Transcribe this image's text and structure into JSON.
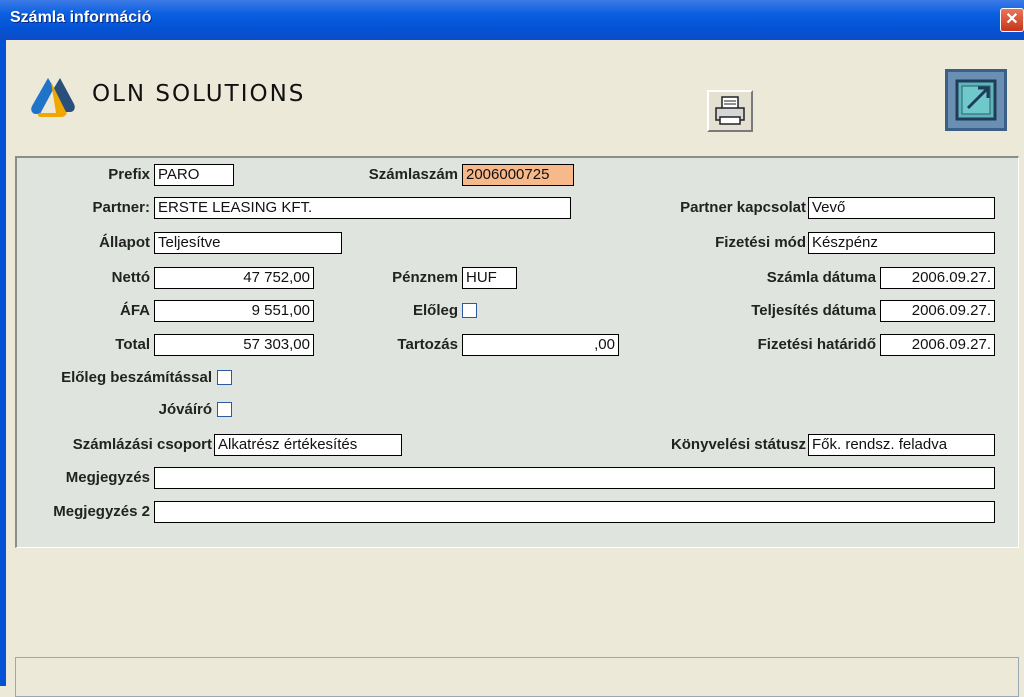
{
  "window": {
    "title": "Számla információ",
    "close_label": "✕"
  },
  "logo": {
    "text": "OLN SOLUTIONS"
  },
  "toolbar": {
    "print_icon": "printer-icon",
    "exit_icon": "exit-icon"
  },
  "form": {
    "prefix": {
      "label": "Prefix",
      "value": "PARO"
    },
    "szamlaszam": {
      "label": "Számlaszám",
      "value": "2006000725"
    },
    "partner": {
      "label": "Partner:",
      "value": "ERSTE LEASING KFT."
    },
    "partner_kapcsolat": {
      "label": "Partner kapcsolat",
      "value": "Vevő"
    },
    "allapot": {
      "label": "Állapot",
      "value": "Teljesítve"
    },
    "fizetesi_mod": {
      "label": "Fizetési mód",
      "value": "Készpénz"
    },
    "netto": {
      "label": "Nettó",
      "value": "47 752,00"
    },
    "penznem": {
      "label": "Pénznem",
      "value": "HUF"
    },
    "szamla_datuma": {
      "label": "Számla dátuma",
      "value": "2006.09.27."
    },
    "afa": {
      "label": "ÁFA",
      "value": "9 551,00"
    },
    "eloleg": {
      "label": "Előleg",
      "checked": false
    },
    "teljesites_datuma": {
      "label": "Teljesítés dátuma",
      "value": "2006.09.27."
    },
    "total": {
      "label": "Total",
      "value": "57 303,00"
    },
    "tartozas": {
      "label": "Tartozás",
      "value": ",00"
    },
    "fizetesi_hatarido": {
      "label": "Fizetési határidő",
      "value": "2006.09.27."
    },
    "eloleg_beszamitassal": {
      "label": "Előleg beszámítással",
      "checked": false
    },
    "jovairo": {
      "label": "Jóváíró",
      "checked": false
    },
    "szamlazasi_csoport": {
      "label": "Számlázási csoport",
      "value": "Alkatrész értékesítés"
    },
    "konyvelesi_statusz": {
      "label": "Könyvelési státusz",
      "value": "Fők. rendsz. feladva"
    },
    "megjegyzes": {
      "label": "Megjegyzés",
      "value": ""
    },
    "megjegyzes2": {
      "label": "Megjegyzés 2",
      "value": ""
    }
  },
  "colors": {
    "titlebar": "#0453d6",
    "panel": "#dfe5de",
    "highlight": "#f7b88a",
    "window": "#ece9d8"
  }
}
